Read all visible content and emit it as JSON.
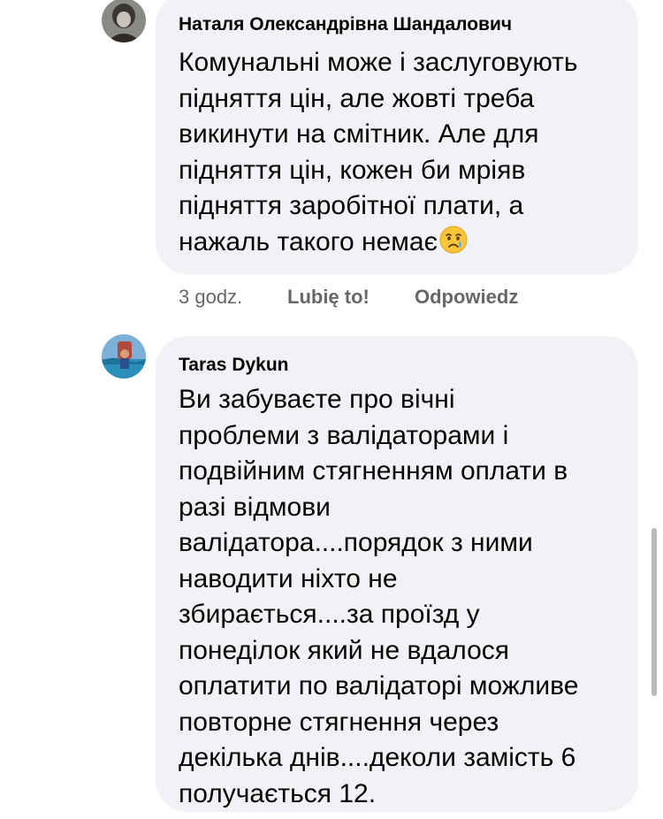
{
  "comments": [
    {
      "author": "Наталя Олександрівна Шандалович",
      "lines": [
        "Комунальні може і заслуговують",
        "підняття цін, але жовті треба",
        "викинути на смітник. Але для",
        "підняття цін, кожен би мріяв",
        "підняття заробітної плати, а",
        "нажаль такого немає"
      ],
      "emoji": "crying-face",
      "time": "3 godz.",
      "like_label": "Lubię to!",
      "reply_label": "Odpowiedz"
    },
    {
      "author": "Taras Dykun",
      "lines": [
        "Ви забуваєте про вічні",
        "проблеми з валідаторами і",
        "подвійним стягненням оплати в",
        "разі відмови",
        "валідатора....порядок з ними",
        "наводити ніхто не",
        "збирається....за проїзд у",
        "понеділок який не вдалося",
        "оплатити по валідаторі можливе",
        "повторне стягнення через",
        "декілька днів....деколи замість 6",
        "получається 12."
      ]
    }
  ],
  "colors": {
    "bubble": "#f0f2f5",
    "text": "#050505",
    "secondary": "#65676b"
  }
}
